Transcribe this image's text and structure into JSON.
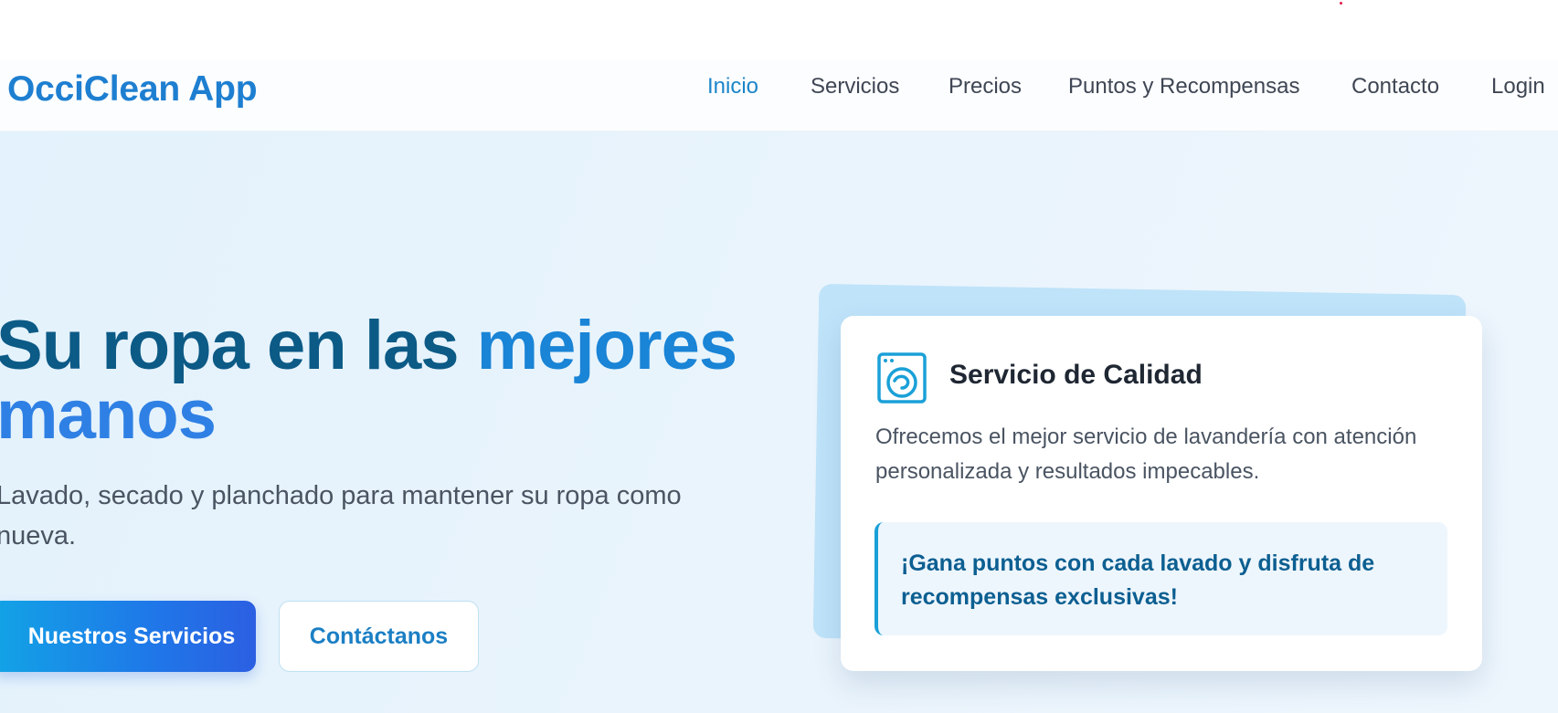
{
  "brand": {
    "name": "OcciClean App"
  },
  "nav": {
    "items": [
      {
        "label": "Inicio",
        "active": true
      },
      {
        "label": "Servicios",
        "active": false
      },
      {
        "label": "Precios",
        "active": false
      },
      {
        "label": "Puntos y Recompensas",
        "active": false
      },
      {
        "label": "Contacto",
        "active": false
      },
      {
        "label": "Login",
        "active": false
      }
    ]
  },
  "hero": {
    "title_part1": "Su ropa en las ",
    "title_accent": "mejores",
    "title_line2": "manos",
    "subtitle": "Lavado, secado y planchado para mantener su ropa como nueva.",
    "primary_button": "Nuestros Servicios",
    "secondary_button": "Contáctanos"
  },
  "card": {
    "icon": "washing-machine-icon",
    "title": "Servicio de Calidad",
    "text": "Ofrecemos el mejor servicio de lavandería con atención personalizada y resultados impecables.",
    "callout": "¡Gana puntos con cada lavado y disfruta de recompensas exclusivas!"
  },
  "colors": {
    "brand": "#1e7fd1",
    "title_dark": "#0c5a86",
    "title_accent": "#1a84d6",
    "nav_active": "#1b85c9",
    "hero_background": "#e3f2fc",
    "card_back": "#bfe3f9",
    "callout_border": "#1aa0d8"
  }
}
